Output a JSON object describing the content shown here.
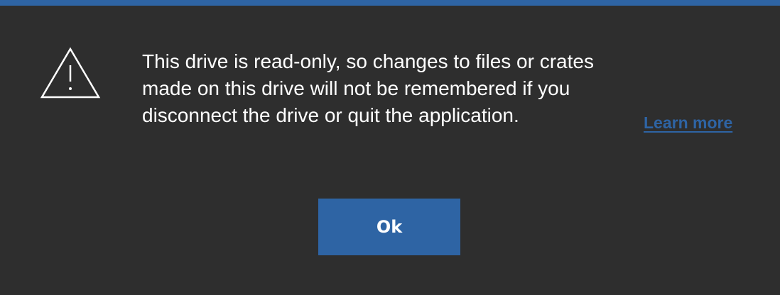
{
  "dialog": {
    "icon": "warning-triangle-icon",
    "message": "This drive is read-only, so changes to files or crates made on this drive will not be remembered if you disconnect the drive or quit the application.",
    "learn_more_label": "Learn more",
    "ok_label": "Ok"
  },
  "colors": {
    "background": "#2e2e2e",
    "accent": "#2e64a4",
    "text": "#ffffff"
  }
}
